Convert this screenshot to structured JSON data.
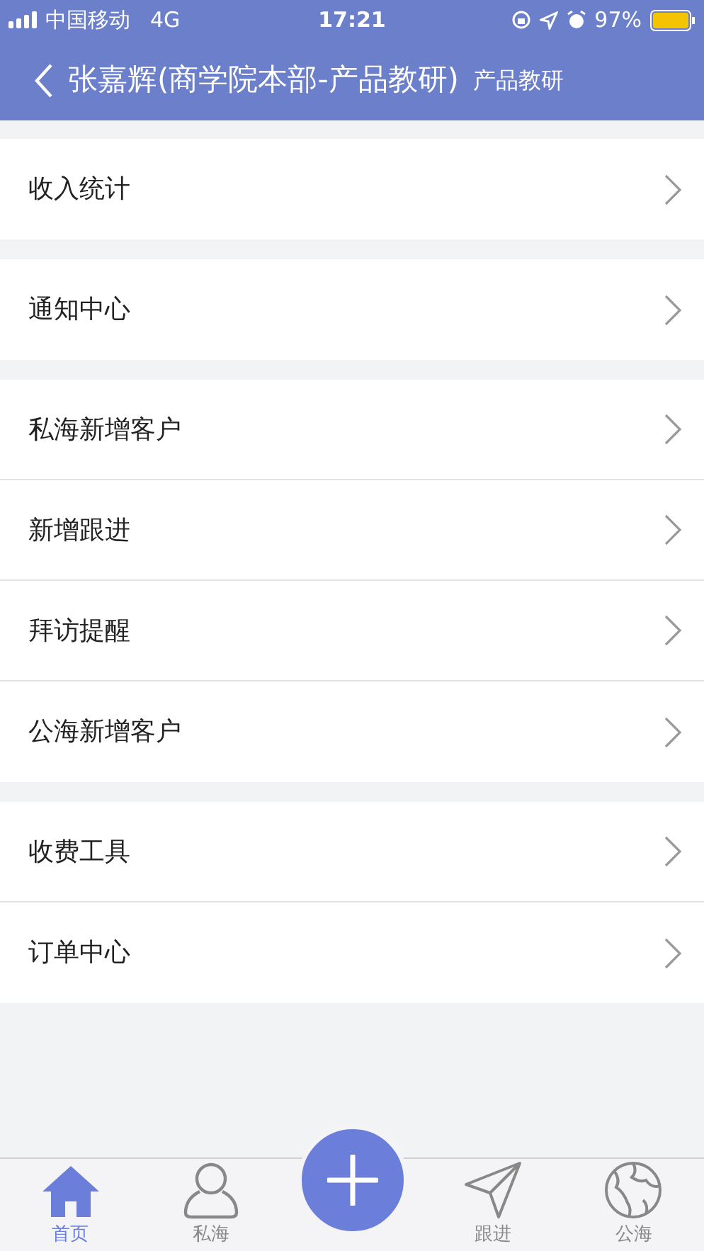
{
  "status_bar": {
    "carrier": "中国移动",
    "network": "4G",
    "time": "17:21",
    "battery": "97%"
  },
  "header": {
    "title": "张嘉辉(商学院本部-产品教研)",
    "subtitle": "产品教研"
  },
  "groups": [
    {
      "items": [
        "收入统计"
      ]
    },
    {
      "items": [
        "通知中心"
      ]
    },
    {
      "items": [
        "私海新增客户",
        "新增跟进",
        "拜访提醒",
        "公海新增客户"
      ]
    },
    {
      "items": [
        "收费工具",
        "订单中心"
      ]
    }
  ],
  "tab_bar": [
    {
      "label": "首页",
      "kind": "home",
      "selected": true
    },
    {
      "label": "私海",
      "kind": "person",
      "selected": false
    },
    {
      "kind": "add"
    },
    {
      "label": "跟进",
      "kind": "send",
      "selected": false
    },
    {
      "label": "公海",
      "kind": "globe",
      "selected": false
    }
  ]
}
